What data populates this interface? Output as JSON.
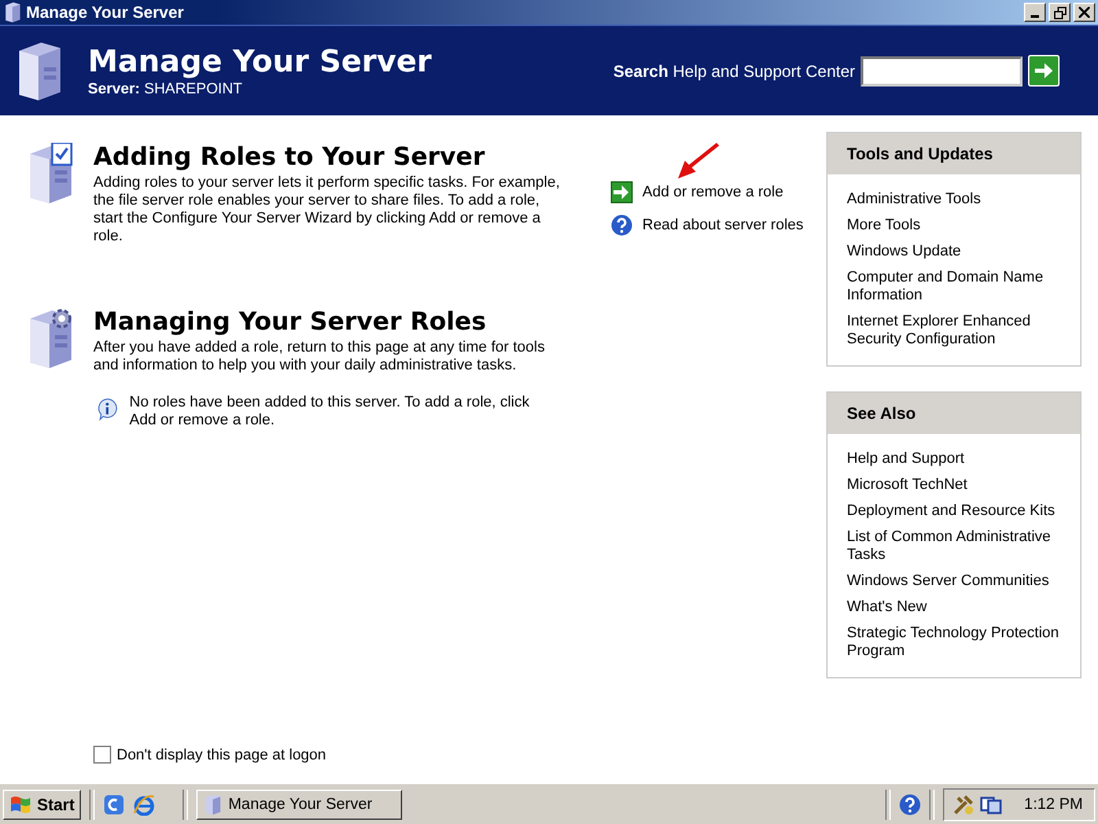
{
  "window": {
    "title": "Manage Your Server"
  },
  "header": {
    "title": "Manage Your Server",
    "server": "**Server:** SHAREPOINT",
    "search_label": "**Search** Help and Support Center"
  },
  "sections": [
    {
      "kind": "add",
      "title": "Adding Roles to Your Server",
      "description": "Adding roles to your server lets it perform specific tasks. For example, the file server role enables your server to share files. To add a role, start the Configure Your Server Wizard by clicking Add or remove a role.",
      "links": [
        {
          "kind": "go",
          "label": "Add or remove a role"
        },
        {
          "kind": "help",
          "label": "Read about server roles"
        }
      ]
    },
    {
      "kind": "manage",
      "title": "Managing Your Server Roles",
      "description": "After you have added a role, return to this page at any time for tools and information to help you with your daily administrative tasks.",
      "note": "No roles have been added to this server. To add a role, click Add or remove a role."
    }
  ],
  "panels": [
    {
      "title": "Tools and Updates",
      "items": [
        "Administrative Tools",
        "More Tools",
        "Windows Update",
        "Computer and Domain Name Information",
        "Internet Explorer Enhanced Security Configuration"
      ]
    },
    {
      "title": "See Also",
      "items": [
        "Help and Support",
        "Microsoft TechNet",
        "Deployment and Resource Kits",
        "List of Common Administrative Tasks",
        "Windows Server Communities",
        "What's New",
        "Strategic Technology Protection Program"
      ]
    }
  ],
  "startup_checkbox": {
    "label": "Don't display this page at logon",
    "checked": false
  },
  "taskbar": {
    "start": "Start",
    "tasks": [
      {
        "label": "Manage Your Server",
        "selected": false
      }
    ],
    "clock": "1:12 PM"
  }
}
